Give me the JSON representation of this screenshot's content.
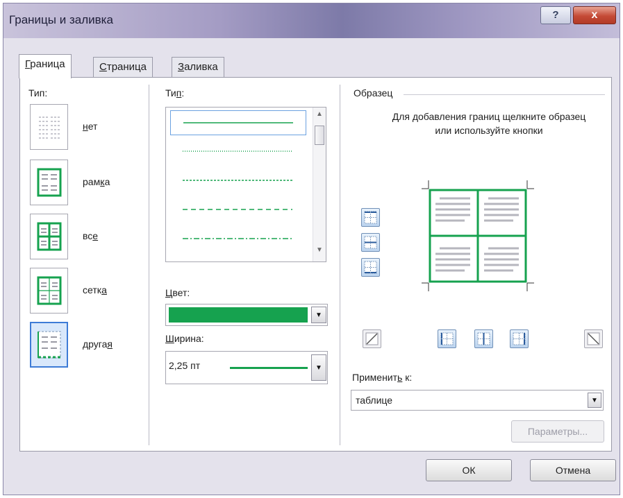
{
  "window": {
    "title": "Границы и заливка",
    "help": "?",
    "close": "x"
  },
  "tabs": [
    {
      "label": "Граница",
      "key": "Г",
      "rest": "раница"
    },
    {
      "label": "Страница",
      "key": "С",
      "rest": "траница"
    },
    {
      "label": "Заливка",
      "key": "З",
      "rest": "аливка"
    }
  ],
  "setting": {
    "label": "Тип:",
    "items": [
      {
        "pre": "",
        "key": "н",
        "post": "ет"
      },
      {
        "pre": "рам",
        "key": "к",
        "post": "а"
      },
      {
        "pre": "вс",
        "key": "е",
        "post": ""
      },
      {
        "pre": "сетк",
        "key": "а",
        "post": ""
      },
      {
        "pre": "друга",
        "key": "я",
        "post": ""
      }
    ]
  },
  "style": {
    "label_pre": "Ти",
    "label_key": "п",
    "label_post": ":"
  },
  "color": {
    "label_key": "Ц",
    "label_rest": "вет:",
    "value": "#16a24f"
  },
  "width": {
    "label_key": "Ш",
    "label_rest": "ирина:",
    "value": "2,25 пт"
  },
  "preview": {
    "title": "Образец",
    "hint": "Для добавления границ щелкните образец или используйте кнопки",
    "border_color": "#16a24f"
  },
  "apply_to": {
    "label_pre": "Применит",
    "label_key": "ь",
    "label_post": " к:",
    "value": "таблице"
  },
  "buttons": {
    "options": "Параметры...",
    "ok": "ОК",
    "cancel": "Отмена"
  }
}
